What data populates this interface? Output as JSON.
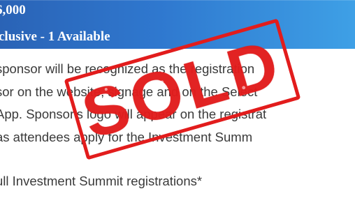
{
  "header": {
    "price": "6,000",
    "availability": "clusive - 1 Available"
  },
  "description": {
    "lines": [
      "sponsor will be recognized as the registration",
      "sor on the website, signage and on the Select",
      "App. Sponsor's logo will appear on the registrat",
      " as attendees apply for the Investment Summ"
    ],
    "note": "ull Investment Summit registrations*"
  },
  "stamp": {
    "label": "SOLD",
    "color": "#e21c1c"
  },
  "colors": {
    "header_start": "#2a63b6",
    "header_end": "#3ea0e6",
    "text": "#3a3a3a"
  }
}
